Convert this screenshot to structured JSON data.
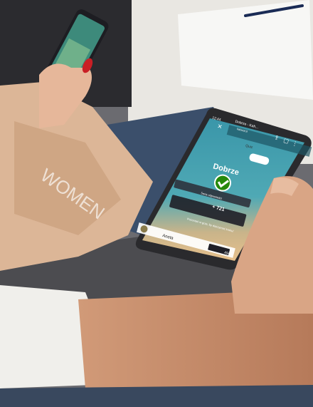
{
  "photo": {
    "phone_screen": {
      "status_time": "12:44",
      "browser_title": "Dobrze - Kah...",
      "browser_url": "kahoot.it",
      "badge_label": "Quiz",
      "result_text": "Dobrze",
      "streak_label": "Seria odpowiedzi",
      "points_text": "+ 721",
      "message_text": "Pozostań w grze, by dotrzymać kroku!",
      "player_name": "Aneta",
      "score_text": "4943"
    },
    "colors": {
      "screen_top": "#3a96a9",
      "screen_bottom": "#e6c08c",
      "result_green": "#26890c",
      "scarlet_nail": "#c91f25"
    },
    "icons": [
      "close-icon",
      "share-icon",
      "tabs-icon",
      "menu-dots-icon",
      "check-icon",
      "avatar-icon"
    ]
  }
}
